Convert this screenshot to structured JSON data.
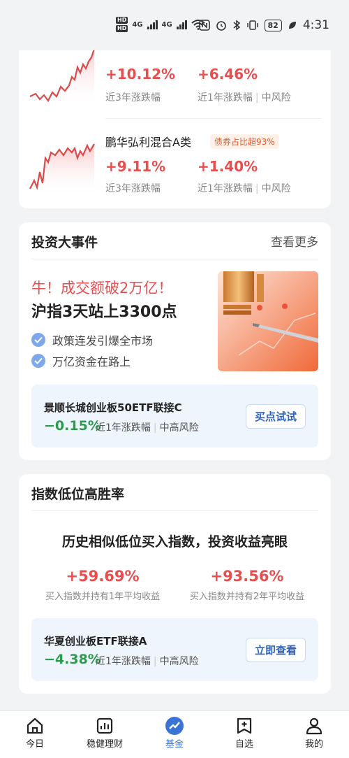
{
  "status_bar": {
    "hd1": "HD",
    "hd2": "HD",
    "net1": "4G",
    "net2": "4G",
    "battery": "82",
    "time": "4:31"
  },
  "funds": [
    {
      "name": "",
      "pct_3y": "+10.12%",
      "label_3y": "近3年涨跌幅",
      "pct_1y": "+6.46%",
      "label_1y": "近1年涨跌幅",
      "risk": "中风险"
    },
    {
      "name": "鹏华弘利混合A类",
      "tag": "债券占比超93%",
      "pct_3y": "+9.11%",
      "label_3y": "近3年涨跌幅",
      "pct_1y": "+1.40%",
      "label_1y": "近1年涨跌幅",
      "risk": "中风险"
    }
  ],
  "events": {
    "title": "投资大事件",
    "more": "查看更多",
    "headline_red": "牛！成交额破2万亿！",
    "headline_black": "沪指3天站上3300点",
    "bullets": [
      "政策连发引爆全市场",
      "万亿资金在路上"
    ],
    "rec": {
      "name": "景顺长城创业板50ETF联接C",
      "pct": "−0.15%",
      "pct_label": "近1年涨跌幅",
      "risk": "中高风险",
      "button": "买点试试"
    }
  },
  "index": {
    "title": "指数低位高胜率",
    "headline": "历史相似低位买入指数，投资收益亮眼",
    "stats": [
      {
        "value": "+59.69%",
        "label": "买入指数并持有1年平均收益"
      },
      {
        "value": "+93.56%",
        "label": "买入指数并持有2年平均收益"
      }
    ],
    "rec": {
      "name": "华夏创业板ETF联接A",
      "pct": "−4.38%",
      "pct_label": "近1年涨跌幅",
      "risk": "中高风险",
      "button": "立即查看"
    }
  },
  "nav": {
    "items": [
      {
        "label": "今日",
        "icon": "home-icon"
      },
      {
        "label": "稳健理财",
        "icon": "chart-box-icon"
      },
      {
        "label": "基金",
        "icon": "fund-trend-icon"
      },
      {
        "label": "自选",
        "icon": "add-favorite-icon"
      },
      {
        "label": "我的",
        "icon": "person-icon"
      }
    ],
    "active_index": 2
  },
  "colors": {
    "up_red": "#e94e4e",
    "down_green": "#2e9a4e",
    "accent_blue": "#3a72d6",
    "tag_orange": "#e05a2b"
  }
}
